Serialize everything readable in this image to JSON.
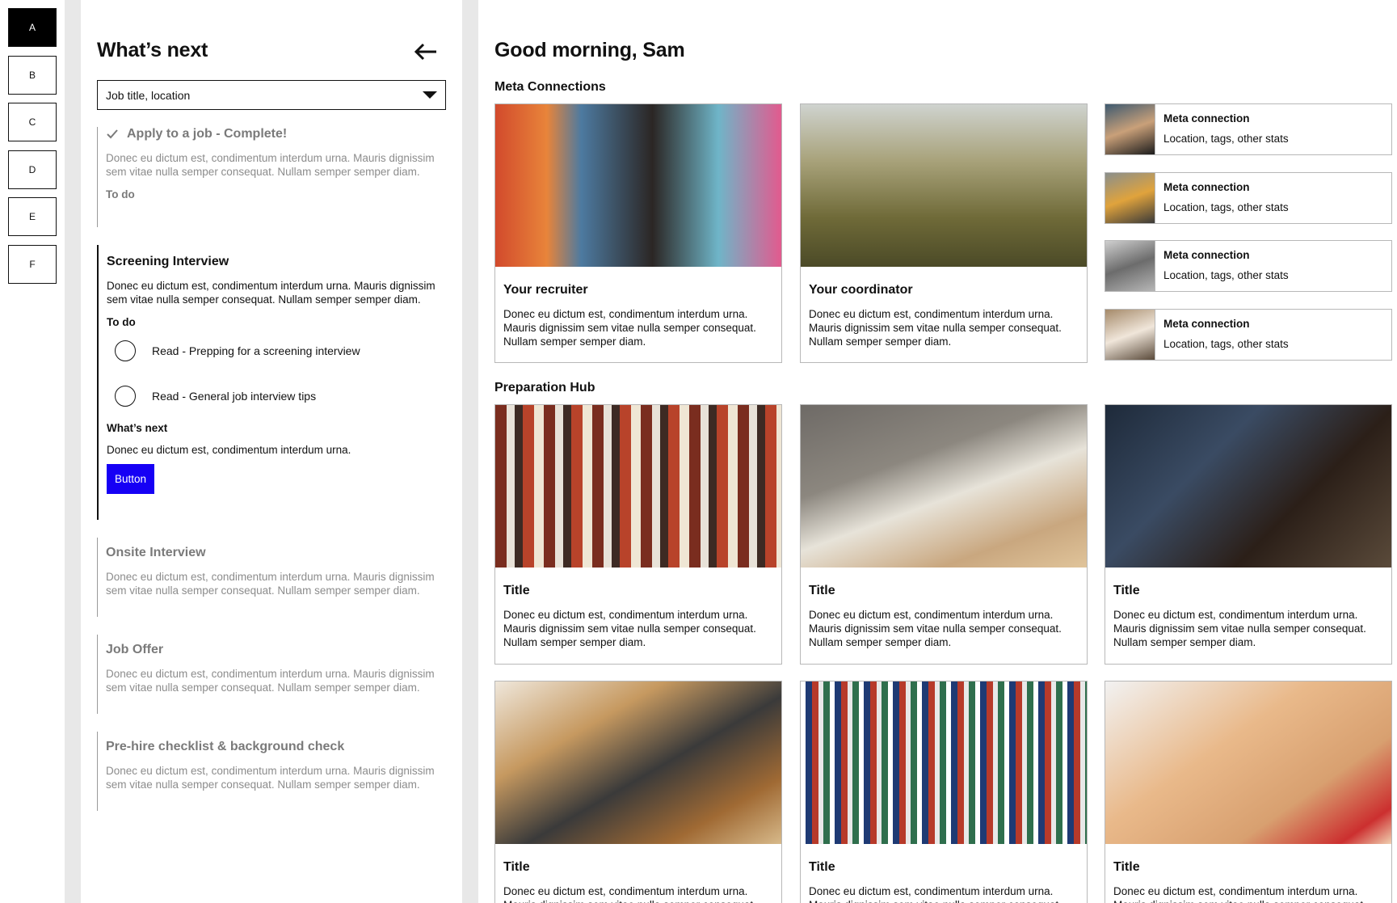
{
  "rail": {
    "tabs": [
      "A",
      "B",
      "C",
      "D",
      "E",
      "F"
    ],
    "active_index": 0
  },
  "panel": {
    "title": "What’s next",
    "filter": {
      "value": "Job title, location"
    },
    "steps": [
      {
        "title": "Apply to a job - Complete!",
        "status": "complete",
        "desc": "Donec eu dictum est, condimentum interdum urna. Mauris dignissim sem vitae nulla semper consequat. Nullam semper semper diam.",
        "todo_label": "To do"
      },
      {
        "title": "Screening Interview",
        "status": "current",
        "desc": "Donec eu dictum est, condimentum interdum urna. Mauris dignissim sem vitae nulla semper consequat. Nullam semper semper diam.",
        "todo_label": "To do",
        "todos": [
          "Read - Prepping for a screening interview",
          "Read - General job interview tips"
        ],
        "next_label": "What’s next",
        "next_desc": "Donec eu dictum est, condimentum interdum urna.",
        "button_label": "Button"
      },
      {
        "title": "Onsite Interview",
        "status": "upcoming",
        "desc": "Donec eu dictum est, condimentum interdum urna. Mauris dignissim sem vitae nulla semper consequat. Nullam semper semper diam."
      },
      {
        "title": "Job Offer",
        "status": "upcoming",
        "desc": "Donec eu dictum est, condimentum interdum urna. Mauris dignissim sem vitae nulla semper consequat. Nullam semper semper diam."
      },
      {
        "title": "Pre-hire checklist & background check",
        "status": "upcoming",
        "desc": "Donec eu dictum est, condimentum interdum urna. Mauris dignissim sem vitae nulla semper consequat. Nullam semper semper diam."
      }
    ]
  },
  "main": {
    "greeting": "Good morning, Sam",
    "connections": {
      "label": "Meta Connections",
      "cards": [
        {
          "title": "Your recruiter",
          "desc": "Donec eu dictum est, condimentum interdum urna. Mauris dignissim sem vitae nulla semper consequat. Nullam semper semper diam."
        },
        {
          "title": "Your coordinator",
          "desc": "Donec eu dictum est, condimentum interdum urna. Mauris dignissim sem vitae nulla semper consequat. Nullam semper semper diam."
        }
      ],
      "mini": [
        {
          "title": "Meta connection",
          "sub": "Location, tags, other stats"
        },
        {
          "title": "Meta connection",
          "sub": "Location, tags, other stats"
        },
        {
          "title": "Meta connection",
          "sub": "Location, tags, other stats"
        },
        {
          "title": "Meta connection",
          "sub": "Location, tags, other stats"
        }
      ]
    },
    "prep": {
      "label": "Preparation Hub",
      "cards": [
        {
          "title": "Title",
          "desc": "Donec eu dictum est, condimentum interdum urna. Mauris dignissim sem vitae nulla semper consequat. Nullam semper semper diam."
        },
        {
          "title": "Title",
          "desc": "Donec eu dictum est, condimentum interdum urna. Mauris dignissim sem vitae nulla semper consequat. Nullam semper semper diam."
        },
        {
          "title": "Title",
          "desc": "Donec eu dictum est, condimentum interdum urna. Mauris dignissim sem vitae nulla semper consequat. Nullam semper semper diam."
        },
        {
          "title": "Title",
          "desc": "Donec eu dictum est, condimentum interdum urna. Mauris dignissim sem vitae nulla semper consequat. Nullam semper semper diam."
        },
        {
          "title": "Title",
          "desc": "Donec eu dictum est, condimentum interdum urna. Mauris dignissim sem vitae nulla semper consequat. Nullam semper semper diam."
        },
        {
          "title": "Title",
          "desc": "Donec eu dictum est, condimentum interdum urna. Mauris dignissim sem vitae nulla semper consequat. Nullam semper semper diam."
        }
      ]
    }
  },
  "colors": {
    "accent": "#1600f5",
    "muted_text": "#8c8c8c",
    "gutter": "#e8e8e8"
  },
  "icons": {
    "back": "arrow-left-icon",
    "check": "checkmark-icon",
    "caret": "caret-down-icon"
  }
}
